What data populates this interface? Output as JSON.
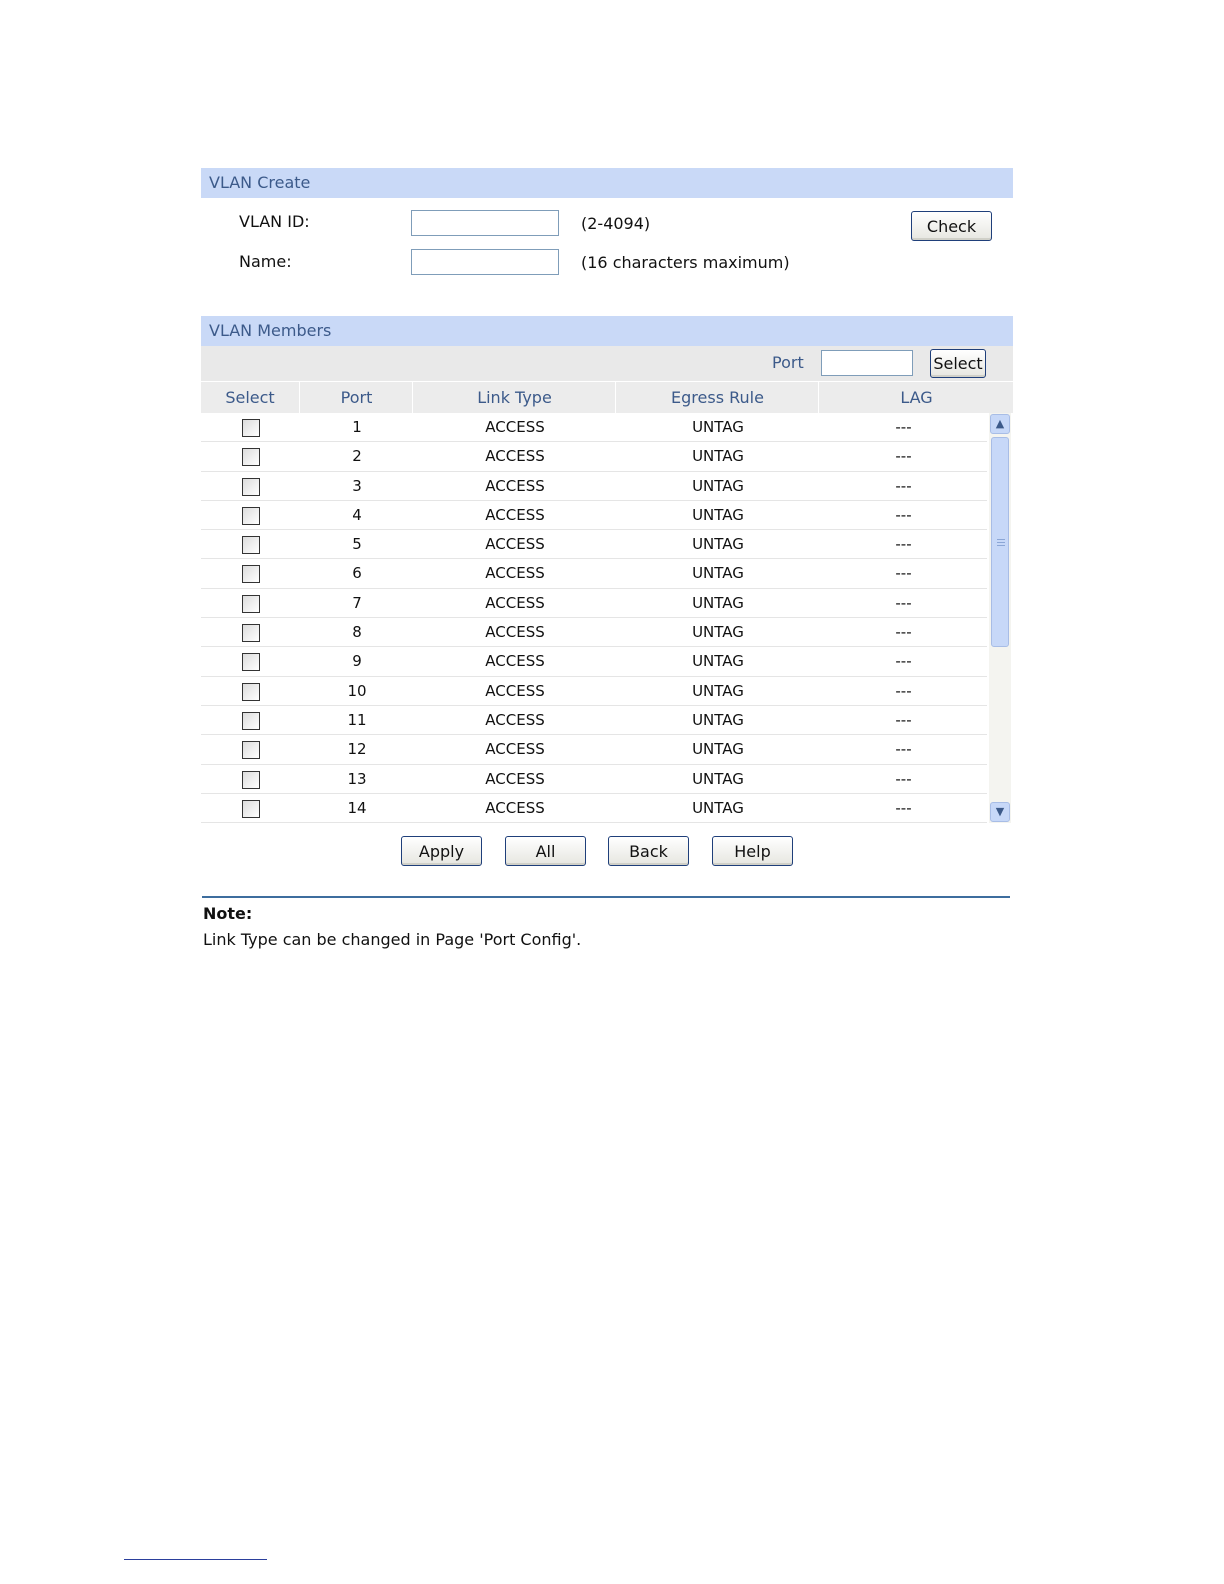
{
  "vlan_create": {
    "title": "VLAN Create",
    "vlan_id_label": "VLAN ID:",
    "vlan_id_value": "",
    "vlan_id_hint": "(2-4094)",
    "name_label": "Name:",
    "name_value": "",
    "name_hint": "(16 characters maximum)",
    "check_button": "Check"
  },
  "vlan_members": {
    "title": "VLAN Members",
    "port_filter_label": "Port",
    "port_filter_value": "",
    "select_button": "Select",
    "columns": [
      "Select",
      "Port",
      "Link Type",
      "Egress Rule",
      "LAG"
    ],
    "rows": [
      {
        "port": "1",
        "link_type": "ACCESS",
        "egress_rule": "UNTAG",
        "lag": "---"
      },
      {
        "port": "2",
        "link_type": "ACCESS",
        "egress_rule": "UNTAG",
        "lag": "---"
      },
      {
        "port": "3",
        "link_type": "ACCESS",
        "egress_rule": "UNTAG",
        "lag": "---"
      },
      {
        "port": "4",
        "link_type": "ACCESS",
        "egress_rule": "UNTAG",
        "lag": "---"
      },
      {
        "port": "5",
        "link_type": "ACCESS",
        "egress_rule": "UNTAG",
        "lag": "---"
      },
      {
        "port": "6",
        "link_type": "ACCESS",
        "egress_rule": "UNTAG",
        "lag": "---"
      },
      {
        "port": "7",
        "link_type": "ACCESS",
        "egress_rule": "UNTAG",
        "lag": "---"
      },
      {
        "port": "8",
        "link_type": "ACCESS",
        "egress_rule": "UNTAG",
        "lag": "---"
      },
      {
        "port": "9",
        "link_type": "ACCESS",
        "egress_rule": "UNTAG",
        "lag": "---"
      },
      {
        "port": "10",
        "link_type": "ACCESS",
        "egress_rule": "UNTAG",
        "lag": "---"
      },
      {
        "port": "11",
        "link_type": "ACCESS",
        "egress_rule": "UNTAG",
        "lag": "---"
      },
      {
        "port": "12",
        "link_type": "ACCESS",
        "egress_rule": "UNTAG",
        "lag": "---"
      },
      {
        "port": "13",
        "link_type": "ACCESS",
        "egress_rule": "UNTAG",
        "lag": "---"
      },
      {
        "port": "14",
        "link_type": "ACCESS",
        "egress_rule": "UNTAG",
        "lag": "---"
      }
    ]
  },
  "actions": {
    "apply": "Apply",
    "all": "All",
    "back": "Back",
    "help": "Help"
  },
  "note": {
    "title": "Note:",
    "text": "Link Type can be changed in Page 'Port Config'."
  },
  "icons": {
    "scroll_up": "chevron-up-icon",
    "scroll_down": "chevron-down-icon"
  },
  "colors": {
    "header_bg": "#c9d9f7",
    "header_text": "#3c5a8a",
    "note_rule": "#3d6d9e"
  }
}
